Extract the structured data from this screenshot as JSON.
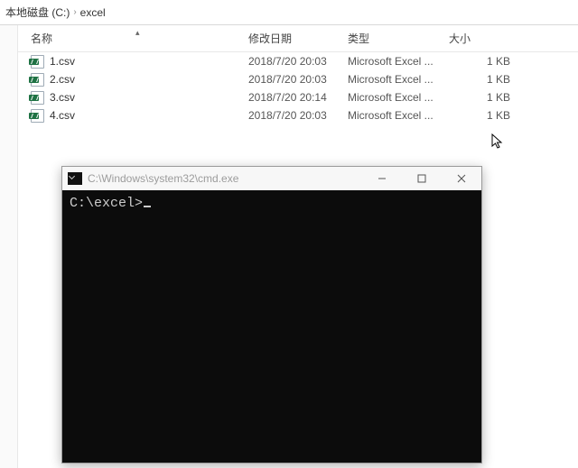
{
  "breadcrumb": {
    "seg0": "本地磁盘 (C:)",
    "seg1": "excel"
  },
  "columns": {
    "name": "名称",
    "date": "修改日期",
    "type": "类型",
    "size": "大小"
  },
  "files": [
    {
      "name": "1.csv",
      "date": "2018/7/20 20:03",
      "type": "Microsoft Excel ...",
      "size": "1 KB"
    },
    {
      "name": "2.csv",
      "date": "2018/7/20 20:03",
      "type": "Microsoft Excel ...",
      "size": "1 KB"
    },
    {
      "name": "3.csv",
      "date": "2018/7/20 20:14",
      "type": "Microsoft Excel ...",
      "size": "1 KB"
    },
    {
      "name": "4.csv",
      "date": "2018/7/20 20:03",
      "type": "Microsoft Excel ...",
      "size": "1 KB"
    }
  ],
  "cmd": {
    "title": "C:\\Windows\\system32\\cmd.exe",
    "prompt": "C:\\excel>"
  }
}
